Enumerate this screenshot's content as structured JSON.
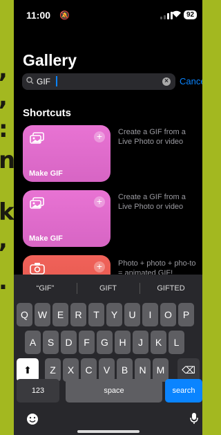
{
  "background_text": [
    ",",
    ",",
    ":",
    "n",
    "k",
    ",",
    "."
  ],
  "status": {
    "time": "11:00",
    "bell": "🔕",
    "battery": "92"
  },
  "header": {
    "title": "Gallery"
  },
  "search": {
    "query": "GIF",
    "cancel": "Cancel"
  },
  "section": {
    "title": "Shortcuts"
  },
  "shortcuts": [
    {
      "name": "Make GIF",
      "description": "Create a GIF from a Live Photo or video",
      "color": "#e873d3",
      "icon": "photos-icon"
    },
    {
      "name": "Make GIF",
      "description": "Create a GIF from a Live Photo or video",
      "color": "#e873d3",
      "icon": "photos-icon"
    },
    {
      "name": "",
      "description": "Photo + photo + pho-to = animated GIF!",
      "color": "#f0625a",
      "icon": "camera-icon"
    }
  ],
  "keyboard": {
    "suggestions": [
      "“GIF”",
      "GIFT",
      "GIFTED"
    ],
    "row1": [
      "Q",
      "W",
      "E",
      "R",
      "T",
      "Y",
      "U",
      "I",
      "O",
      "P"
    ],
    "row2": [
      "A",
      "S",
      "D",
      "F",
      "G",
      "H",
      "J",
      "K",
      "L"
    ],
    "row3": [
      "Z",
      "X",
      "C",
      "V",
      "B",
      "N",
      "M"
    ],
    "numbers": "123",
    "space": "space",
    "search": "search",
    "shift": "⬆",
    "delete": "⌫"
  },
  "colors": {
    "accent": "#0a84ff",
    "card_pink": "#e873d3",
    "card_red": "#f0625a"
  }
}
